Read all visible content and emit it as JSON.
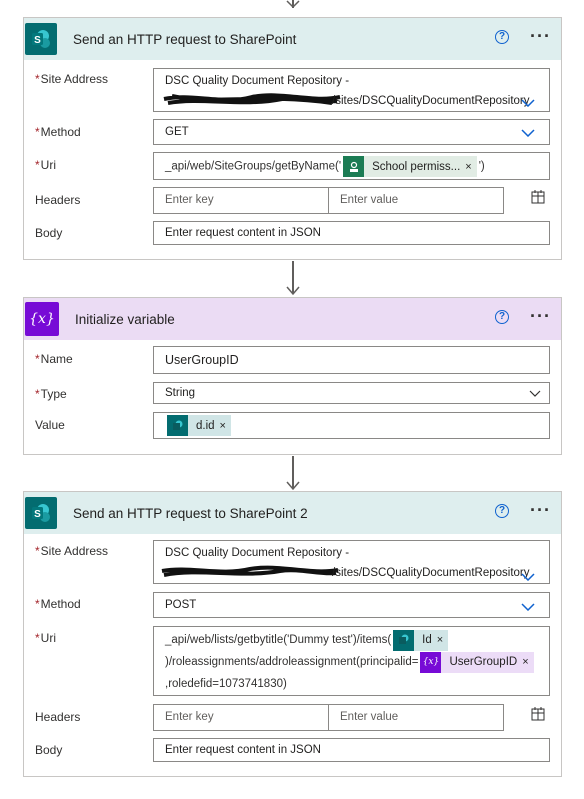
{
  "card1": {
    "title": "Send an HTTP request to SharePoint",
    "site_label": "Site Address",
    "site_line1": "DSC Quality Document Repository -",
    "site_line2": "/sites/DSCQualityDocumentRepository",
    "method_label": "Method",
    "method_value": "GET",
    "uri_label": "Uri",
    "uri_prefix": "_api/web/SiteGroups/getByName('",
    "uri_token": "School permiss...",
    "uri_suffix": "')",
    "headers_label": "Headers",
    "headers_key_placeholder": "Enter key",
    "headers_value_placeholder": "Enter value",
    "body_label": "Body",
    "body_placeholder": "Enter request content in JSON"
  },
  "card2": {
    "title": "Initialize variable",
    "name_label": "Name",
    "name_value": "UserGroupID",
    "type_label": "Type",
    "type_value": "String",
    "value_label": "Value",
    "value_token": "d.id"
  },
  "card3": {
    "title": "Send an HTTP request to SharePoint 2",
    "site_label": "Site Address",
    "site_line1": "DSC Quality Document Repository -",
    "site_line2": "/sites/DSCQualityDocumentRepository",
    "method_label": "Method",
    "method_value": "POST",
    "uri_label": "Uri",
    "uri_part1": "_api/web/lists/getbytitle('Dummy test')/items(",
    "uri_token1": "Id",
    "uri_part2": ")/roleassignments/addroleassignment(principalid=",
    "uri_token2": "UserGroupID",
    "uri_part3": ",roledefid=1073741830)",
    "headers_label": "Headers",
    "headers_key_placeholder": "Enter key",
    "headers_value_placeholder": "Enter value",
    "body_label": "Body",
    "body_placeholder": "Enter request content in JSON"
  },
  "common": {
    "help_glyph": "?",
    "more_glyph": "···",
    "required_mark": "*",
    "remove_glyph": "×",
    "var_icon_text": "{x}",
    "sp_icon_text": "S"
  },
  "icons": [
    "sharepoint-icon",
    "variable-icon",
    "help-icon",
    "more-options-icon",
    "chevron-down-icon",
    "remove-token-icon",
    "switch-to-text-mode-icon",
    "down-arrow-connector-icon"
  ],
  "colors": {
    "sharepoint_header": "#deeeee",
    "sharepoint_brand": "#036c70",
    "variable_header": "#ebdcf4",
    "variable_brand": "#770bd6",
    "accent_blue": "#0f62cf",
    "required_red": "#a4262c"
  }
}
